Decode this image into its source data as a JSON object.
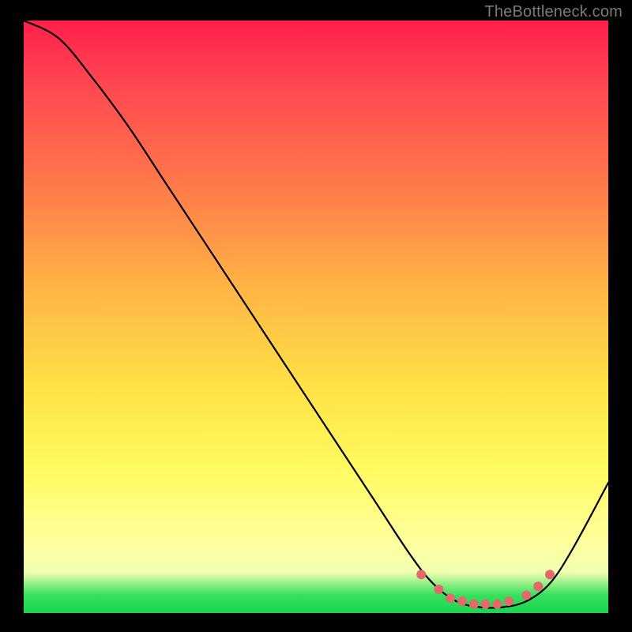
{
  "watermark": "TheBottleneck.com",
  "chart_data": {
    "type": "line",
    "title": "",
    "xlabel": "",
    "ylabel": "",
    "xlim": [
      0,
      100
    ],
    "ylim": [
      0,
      100
    ],
    "series": [
      {
        "name": "bottleneck-curve",
        "x": [
          0,
          6,
          12,
          18,
          24,
          30,
          36,
          42,
          48,
          54,
          60,
          66,
          70,
          74,
          78,
          82,
          86,
          90,
          94,
          100
        ],
        "y": [
          100,
          97,
          90,
          82,
          73,
          64,
          55,
          46,
          37,
          28,
          19,
          10,
          5,
          2,
          1,
          1,
          2,
          5,
          11,
          22
        ]
      }
    ],
    "markers": {
      "name": "optimal-zone",
      "x": [
        68,
        71,
        73,
        75,
        77,
        79,
        81,
        83,
        86,
        88,
        90
      ],
      "y": [
        6.5,
        4,
        2.5,
        2,
        1.5,
        1.5,
        1.5,
        2,
        3,
        4.5,
        6.5
      ]
    },
    "gradient_stops": [
      {
        "pct": 0,
        "color": "#ff1f4b"
      },
      {
        "pct": 10,
        "color": "#ff4451"
      },
      {
        "pct": 28,
        "color": "#ff7a4a"
      },
      {
        "pct": 45,
        "color": "#ffb445"
      },
      {
        "pct": 62,
        "color": "#ffe246"
      },
      {
        "pct": 76,
        "color": "#fffb61"
      },
      {
        "pct": 88,
        "color": "#ffff9e"
      },
      {
        "pct": 93,
        "color": "#f3ffb1"
      },
      {
        "pct": 97,
        "color": "#36e05d"
      },
      {
        "pct": 100,
        "color": "#18d452"
      }
    ],
    "curve_color": "#000000",
    "marker_color": "#e36a6a",
    "marker_radius": 6
  }
}
